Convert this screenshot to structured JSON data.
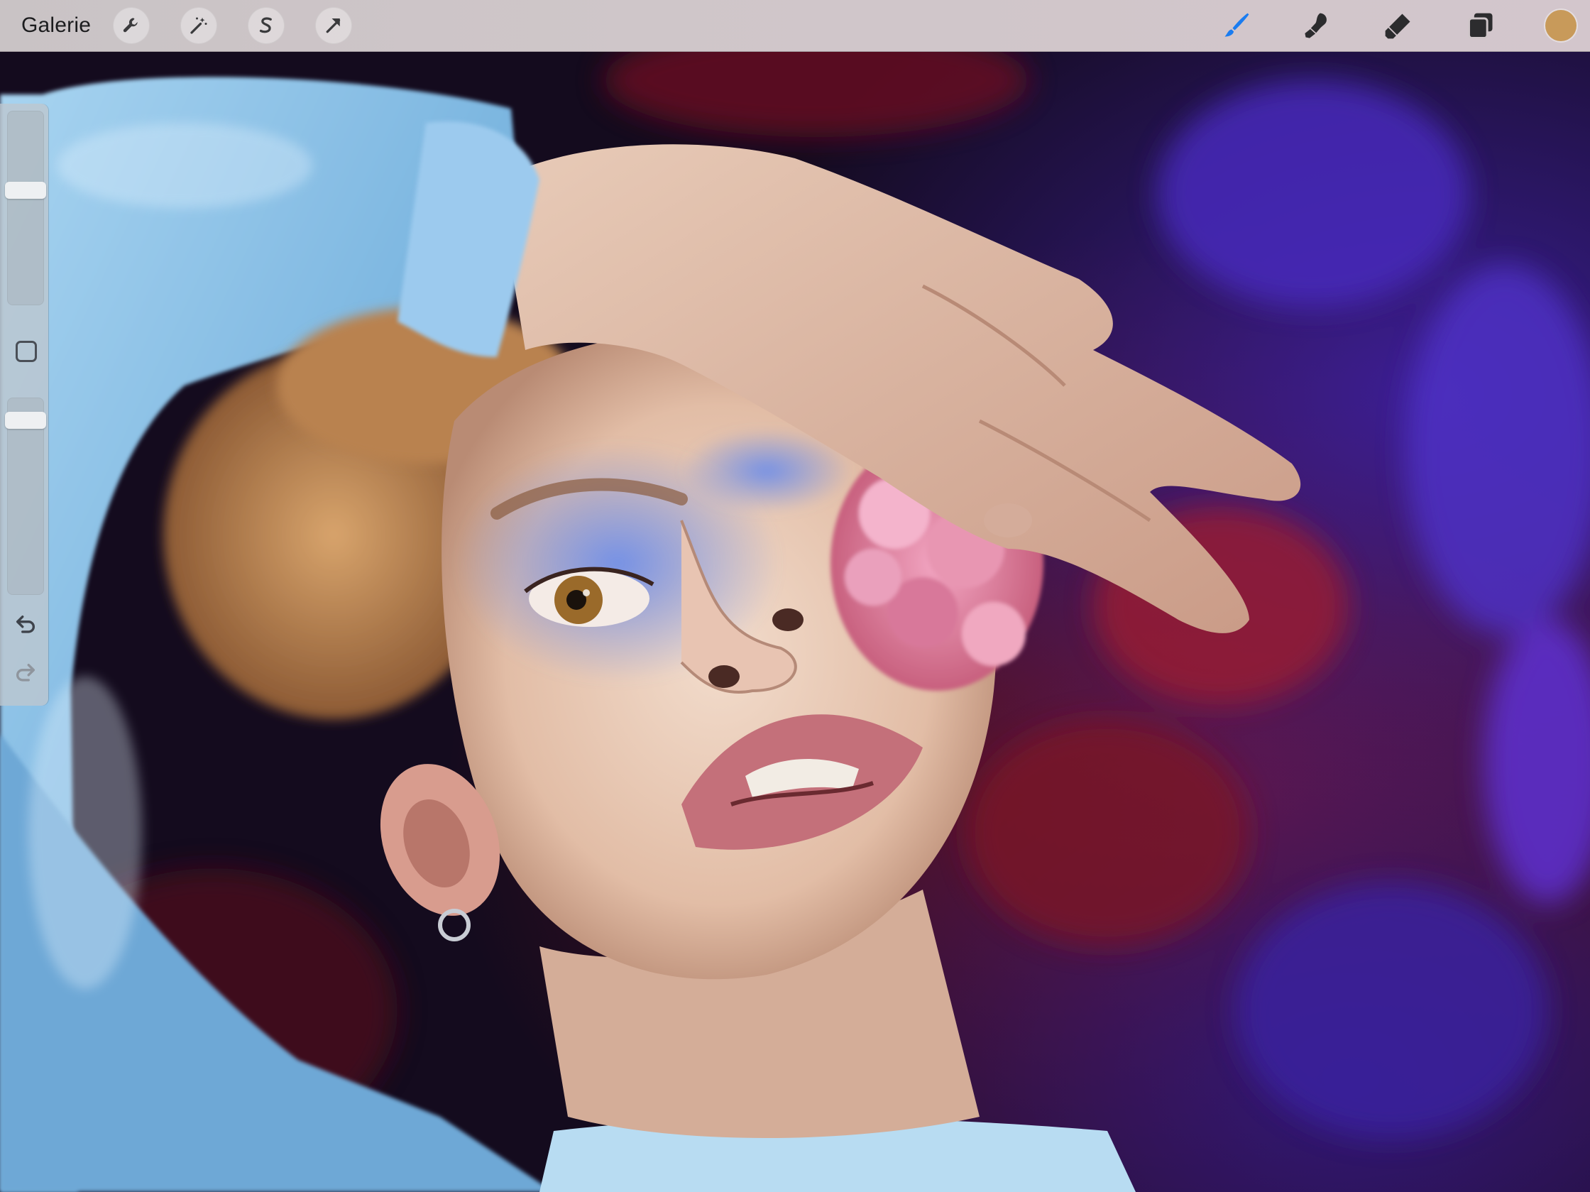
{
  "app": {
    "gallery_label": "Galerie"
  },
  "toolbar": {
    "left_tools": [
      {
        "icon": "wrench-icon",
        "name": "actions"
      },
      {
        "icon": "magic-wand-icon",
        "name": "adjustments"
      },
      {
        "icon": "selection-s-icon",
        "name": "selection"
      },
      {
        "icon": "arrow-cursor-icon",
        "name": "transform"
      }
    ],
    "right_tools": [
      {
        "icon": "brush-icon",
        "name": "paint",
        "active": true
      },
      {
        "icon": "smudge-icon",
        "name": "smudge"
      },
      {
        "icon": "eraser-icon",
        "name": "eraser"
      },
      {
        "icon": "layers-icon",
        "name": "layers"
      }
    ],
    "active_color": "#c89a5a",
    "accent_color": "#1a7cf0"
  },
  "sidebar": {
    "brush_size_level": 0.6,
    "opacity_level": 0.92,
    "undo_icon": "undo-icon",
    "redo_icon": "redo-icon",
    "modify_icon": "square-icon"
  },
  "canvas": {
    "description_colors": {
      "background_dark": "#140b1e",
      "shirt": "#8ec4e8",
      "skin": "#e6c7b2",
      "hair": "#c48e5a",
      "flower": "#e08aa8",
      "eye_paint": "#5a7ad8",
      "fabric_red": "#8a1626",
      "fabric_purple": "#3c1f9a"
    }
  }
}
